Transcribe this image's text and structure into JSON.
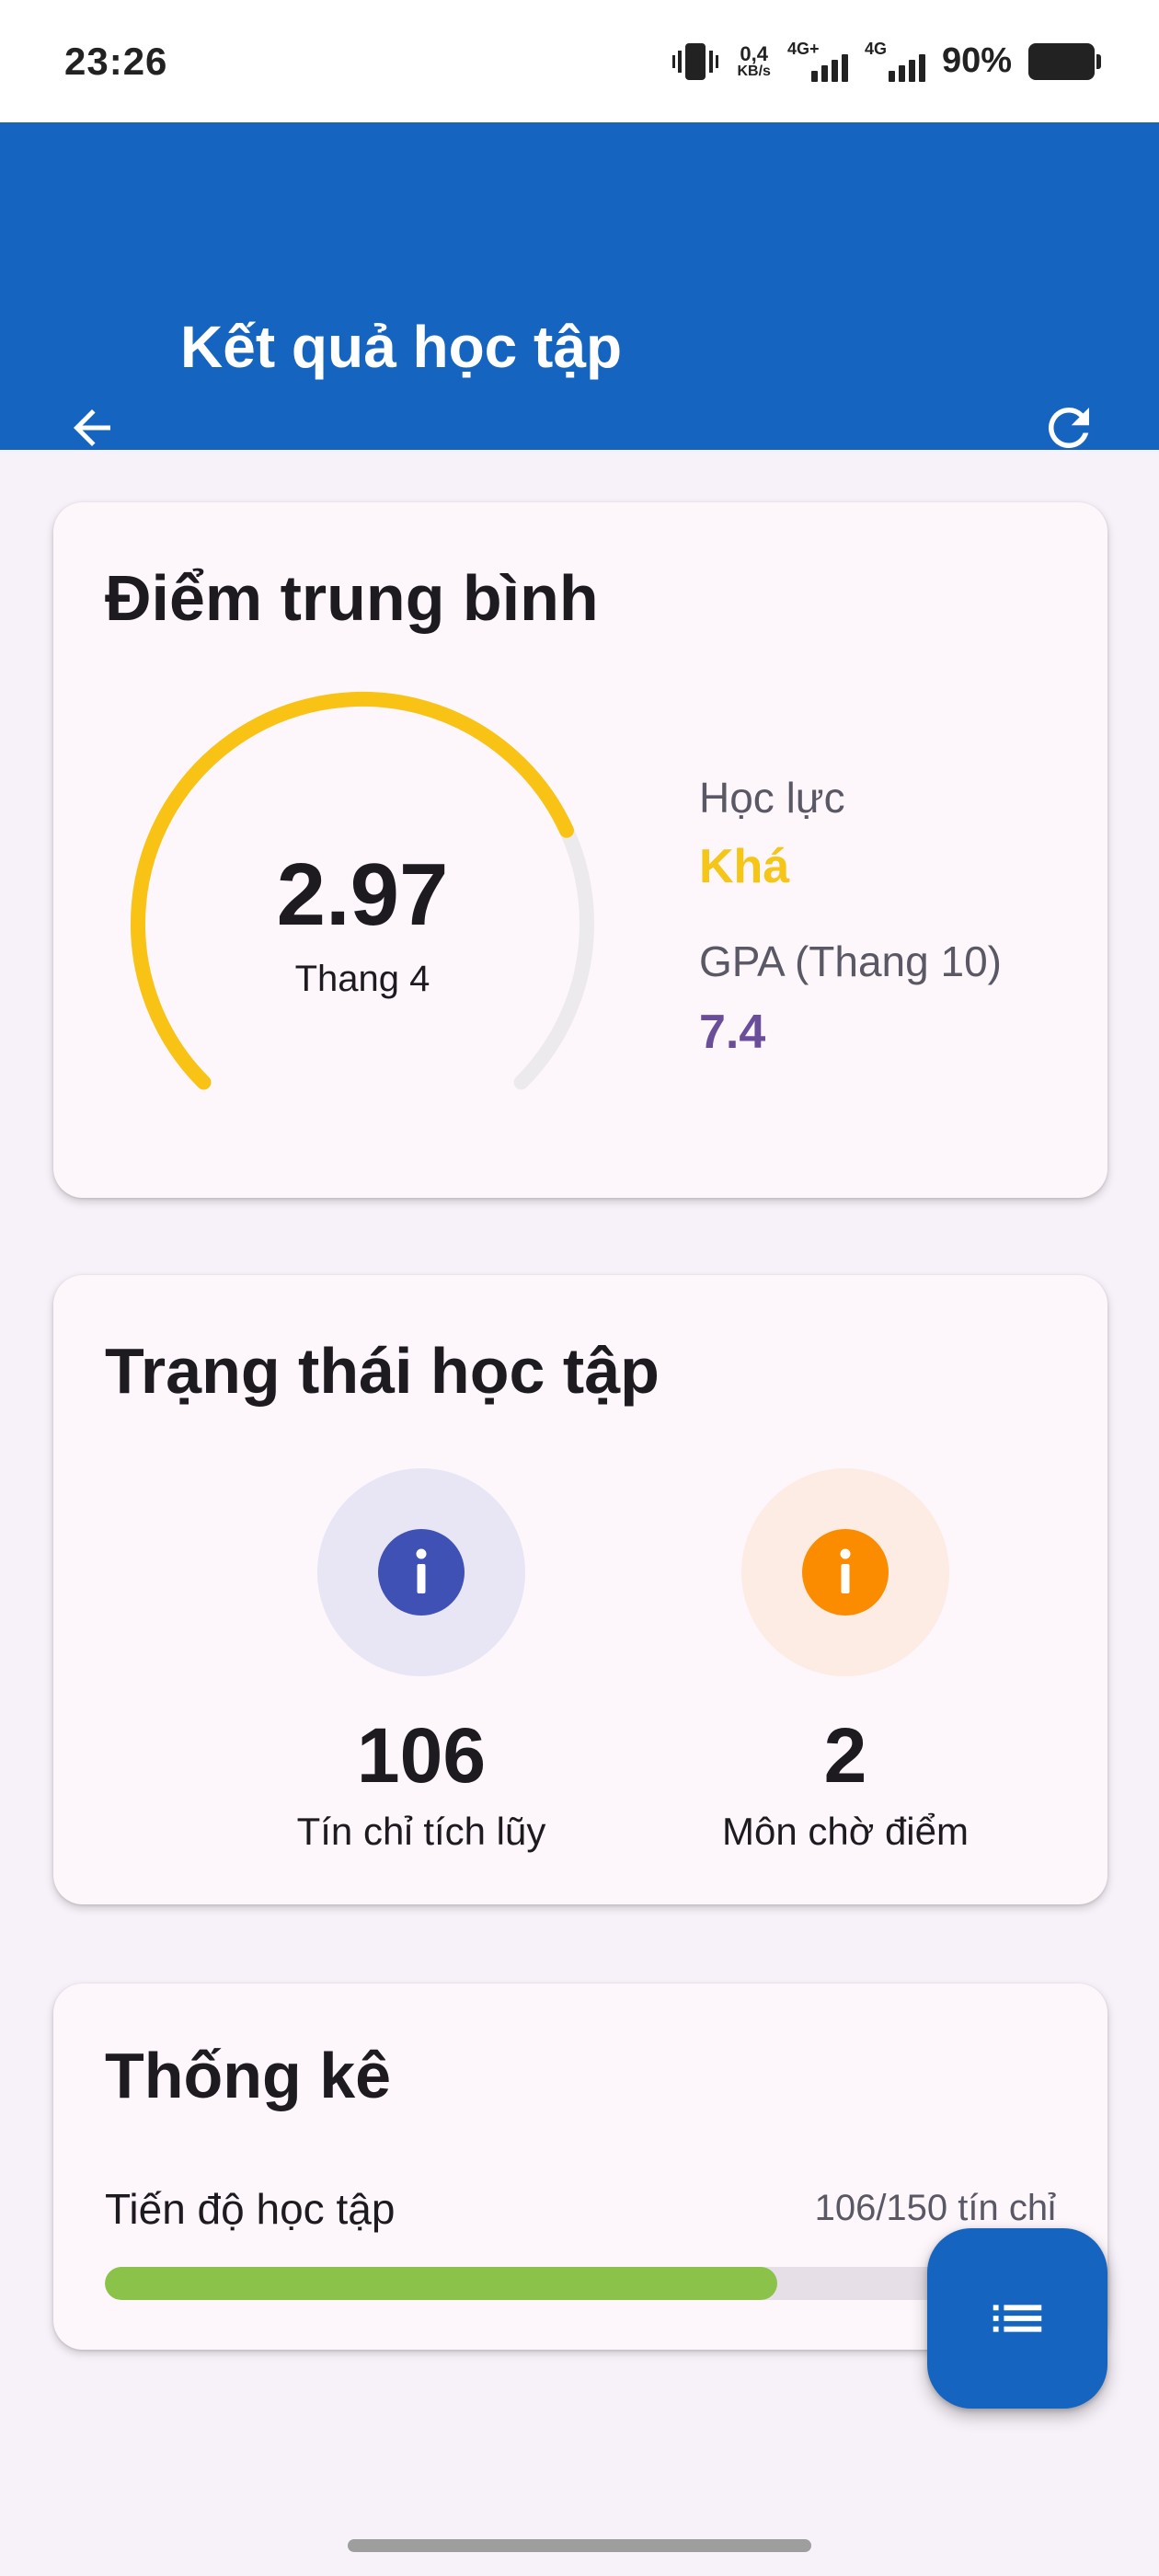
{
  "status_bar": {
    "time": "23:26",
    "net_speed_value": "0,4",
    "net_speed_unit": "KB/s",
    "network_1": "4G+",
    "network_2": "4G",
    "battery": "90%"
  },
  "app_bar": {
    "title": "Kết quả học tập",
    "back_icon": "arrow-back-icon",
    "refresh_icon": "refresh-icon",
    "color": "#1565c0"
  },
  "gpa_card": {
    "title": "Điểm trung bình",
    "gpa_value": "2.97",
    "gpa_scale": "Thang 4",
    "gauge_fraction": 0.7425,
    "gauge_color": "#f9c316",
    "academic_rank_label": "Học lực",
    "academic_rank_value": "Khá",
    "gpa10_label": "GPA (Thang 10)",
    "gpa10_value": "7.4"
  },
  "status_card": {
    "title": "Trạng thái học tập",
    "items": [
      {
        "value": "106",
        "label": "Tín chỉ tích lũy",
        "icon": "info-icon",
        "color": "#3f51b5"
      },
      {
        "value": "2",
        "label": "Môn chờ điểm",
        "icon": "info-icon",
        "color": "#fb8c00"
      }
    ]
  },
  "stats_card": {
    "title": "Thống kê",
    "progress_label": "Tiến độ học tập",
    "progress_text": "106/150 tín chỉ",
    "progress_fraction": 0.7067,
    "progress_color": "#8bc34a"
  },
  "fab": {
    "icon": "list-icon"
  }
}
